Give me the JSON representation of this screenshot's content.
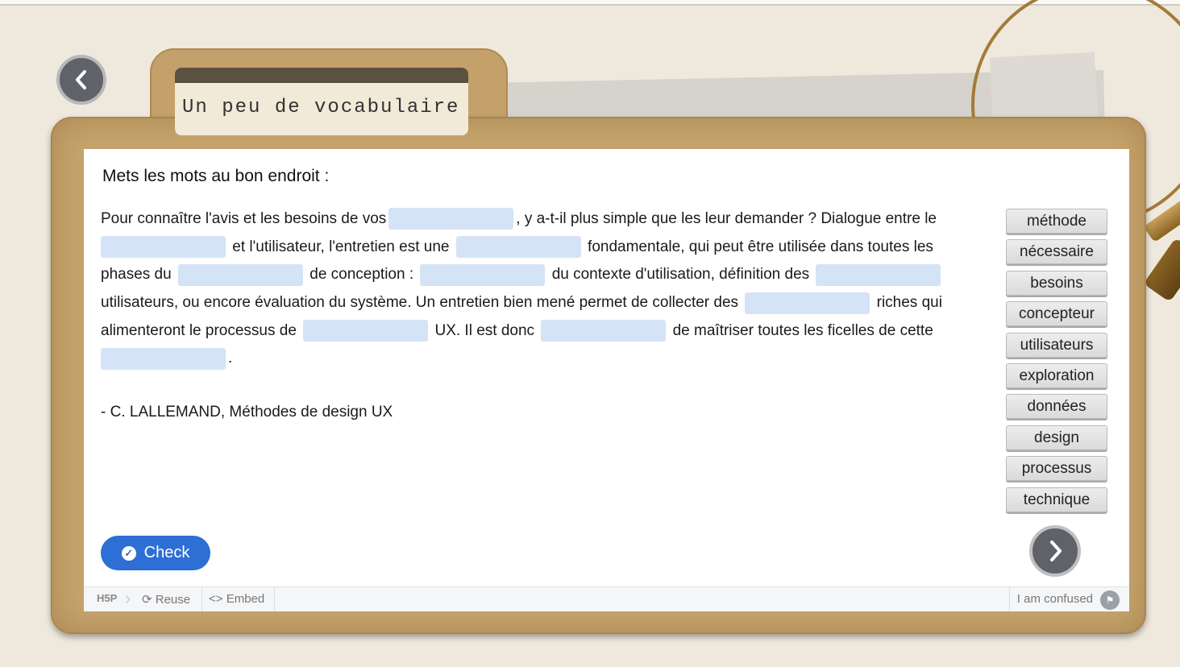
{
  "title": "Un peu de vocabulaire",
  "question": "Mets les mots au bon endroit :",
  "text_lines": [
    [
      "Pour connaître l'avis et les besoins de vos",
      ", y a-t-il plus simple que les leur demander ? Dialogue entre le"
    ],
    [
      "",
      "et l'utilisateur, l'entretien est une",
      "fondamentale, qui peut être utilisée dans toutes les"
    ],
    [
      "phases du",
      "de conception :",
      "du contexte d'utilisation, définition des",
      ""
    ],
    [
      "utilisateurs, ou encore évaluation du système. Un entretien bien mené permet de collecter des",
      "riches qui"
    ],
    [
      "alimenteront le processus de",
      "UX. Il est donc",
      "de maîtriser toutes les ficelles de cette"
    ],
    [
      "",
      "."
    ]
  ],
  "author": "- C. LALLEMAND, Méthodes de design UX",
  "words": [
    "méthode",
    "nécessaire",
    "besoins",
    "concepteur",
    "utilisateurs",
    "exploration",
    "données",
    "design",
    "processus",
    "technique"
  ],
  "check_label": "Check",
  "footer": {
    "h5p": "H5P",
    "reuse": "Reuse",
    "embed": "Embed",
    "confused": "I am confused"
  },
  "colors": {
    "blank": "#d4e3f5",
    "check": "#2d6fd4",
    "folder": "#c6a46d"
  }
}
